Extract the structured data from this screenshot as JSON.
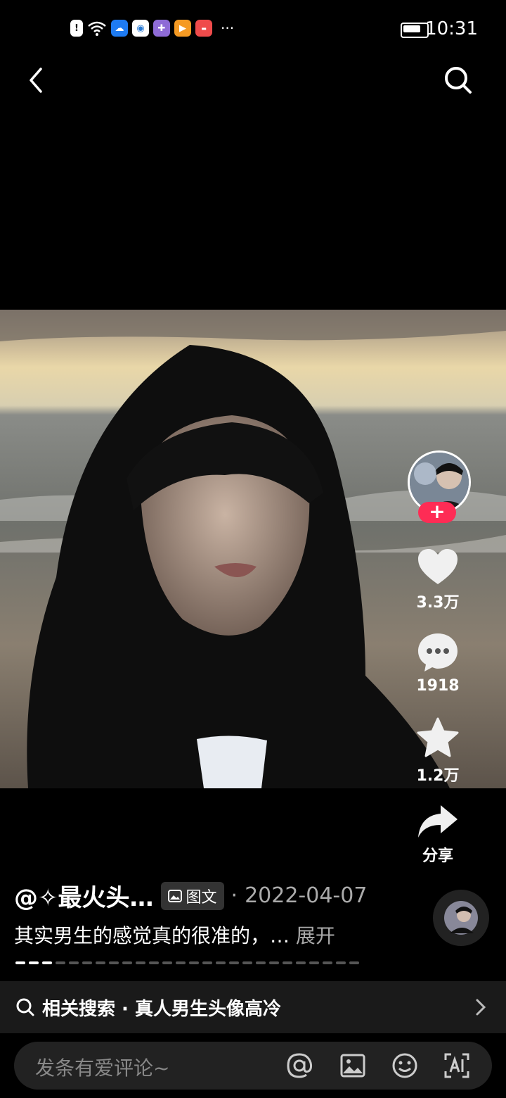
{
  "status_bar": {
    "time": "10:31",
    "more": "···"
  },
  "post": {
    "author": "@✧最火头…",
    "tag": "图文",
    "separator": "·",
    "date": "2022-04-07",
    "caption": "其实男生的感觉真的很准的，…",
    "expand": "展开",
    "carousel": {
      "total": 26,
      "current_index": 0
    }
  },
  "sidebar": {
    "likes": "3.3万",
    "comments": "1918",
    "favorites": "1.2万",
    "share": "分享"
  },
  "related_search": {
    "label": "相关搜索 · 真人男生头像高冷"
  },
  "comment_bar": {
    "placeholder": "发条有爱评论~"
  },
  "colors": {
    "accent": "#fe2c55",
    "background": "#000000"
  }
}
